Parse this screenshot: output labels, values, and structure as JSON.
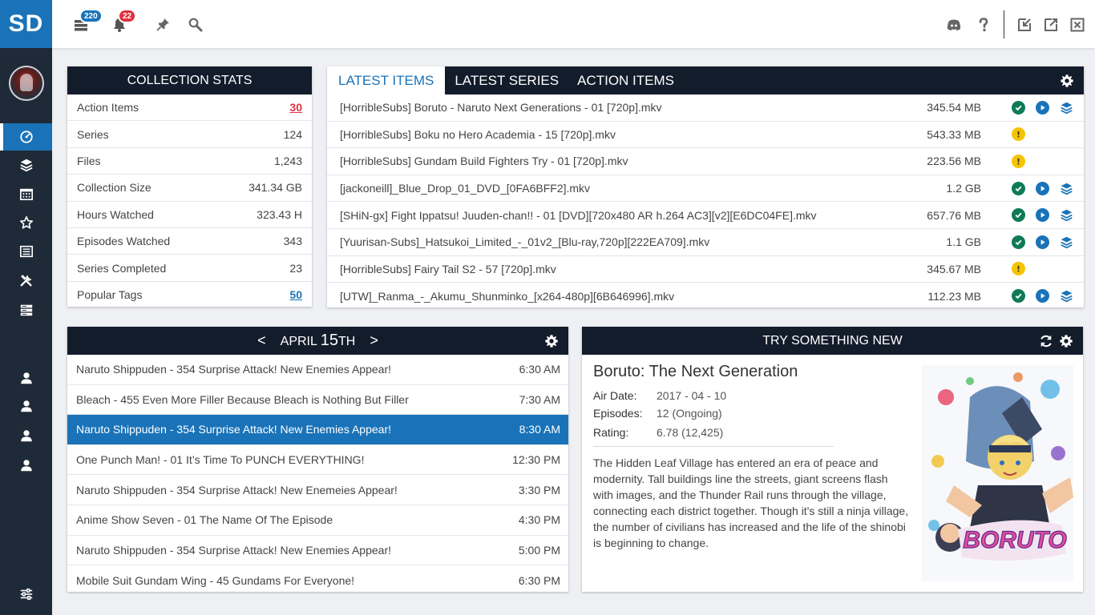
{
  "sidebar": {
    "logo": "SD",
    "items": [
      "dashboard-icon",
      "layers-icon",
      "calendar-icon",
      "star-icon",
      "list-icon",
      "tools-icon",
      "server-icon",
      "user-icon",
      "user-icon",
      "user-icon",
      "user-icon",
      "sliders-icon"
    ]
  },
  "topbar": {
    "queue_count": "220",
    "notification_count": "22",
    "queue_badge_color": "#1a73b8",
    "notification_badge_color": "#e0303f"
  },
  "collection_stats": {
    "title": "COLLECTION STATS",
    "rows": [
      {
        "label": "Action Items",
        "value": "30"
      },
      {
        "label": "Series",
        "value": "124"
      },
      {
        "label": "Files",
        "value": "1,243"
      },
      {
        "label": "Collection Size",
        "value": "341.34 GB"
      },
      {
        "label": "Hours Watched",
        "value": "323.43 H"
      },
      {
        "label": "Episodes Watched",
        "value": "343"
      },
      {
        "label": "Series Completed",
        "value": "23"
      },
      {
        "label": "Popular Tags",
        "value": "50"
      }
    ]
  },
  "latest": {
    "tabs": [
      "LATEST ITEMS",
      "LATEST SERIES",
      "ACTION ITEMS"
    ],
    "files": [
      {
        "name": "[HorribleSubs] Boruto - Naruto Next Generations - 01 [720p].mkv",
        "size": "345.54 MB",
        "status": "ok"
      },
      {
        "name": "[HorribleSubs] Boku no Hero Academia - 15 [720p].mkv",
        "size": "543.33 MB",
        "status": "warn"
      },
      {
        "name": "[HorribleSubs] Gundam Build Fighters Try - 01 [720p].mkv",
        "size": "223.56 MB",
        "status": "warn"
      },
      {
        "name": "[jackoneill]_Blue_Drop_01_DVD_[0FA6BFF2].mkv",
        "size": "1.2 GB",
        "status": "ok"
      },
      {
        "name": "[SHiN-gx] Fight Ippatsu! Juuden-chan!! - 01 [DVD][720x480 AR h.264 AC3][v2][E6DC04FE].mkv",
        "size": "657.76 MB",
        "status": "ok"
      },
      {
        "name": "[Yuurisan-Subs]_Hatsukoi_Limited_-_01v2_[Blu-ray,720p][222EA709].mkv",
        "size": "1.1 GB",
        "status": "ok"
      },
      {
        "name": "[HorribleSubs] Fairy Tail S2 - 57 [720p].mkv",
        "size": "345.67 MB",
        "status": "warn"
      },
      {
        "name": "[UTW]_Ranma_-_Akumu_Shunminko_[x264-480p][6B646996].mkv",
        "size": "112.23 MB",
        "status": "ok"
      }
    ]
  },
  "calendar": {
    "prev": "<",
    "next": ">",
    "month": "APRIL",
    "day": "15",
    "suffix": "TH",
    "rows": [
      {
        "title": "Naruto Shippuden - 354 Surprise Attack! New Enemies Appear!",
        "time": "6:30 AM"
      },
      {
        "title": "Bleach - 455 Even More Filler Because Bleach is Nothing But Filler",
        "time": "7:30 AM"
      },
      {
        "title": "Naruto Shippuden - 354 Surprise Attack! New Enemies Appear!",
        "time": "8:30 AM"
      },
      {
        "title": "One Punch Man! - 01 It’s Time To PUNCH EVERYTHING!",
        "time": "12:30 PM"
      },
      {
        "title": "Naruto Shippuden - 354 Surprise Attack! New Enemeies Appear!",
        "time": "3:30 PM"
      },
      {
        "title": "Anime Show Seven - 01 The Name Of The Episode",
        "time": "4:30 PM"
      },
      {
        "title": "Naruto Shippuden - 354 Surprise Attack! New Enemies Appear!",
        "time": "5:00 PM"
      },
      {
        "title": "Mobile Suit Gundam Wing - 45 Gundams For Everyone!",
        "time": "6:30 PM"
      }
    ]
  },
  "try_new": {
    "header": "TRY SOMETHING NEW",
    "title": "Boruto: The Next Generation",
    "air_date_label": "Air Date:",
    "air_date": "2017 - 04 - 10",
    "episodes_label": "Episodes:",
    "episodes": "12 (Ongoing)",
    "rating_label": "Rating:",
    "rating": "6.78 (12,425)",
    "description": "The Hidden Leaf Village has entered an era of peace and modernity. Tall buildings line the streets, giant screens flash with images, and the Thunder Rail runs through the village, connecting each district together. Though it's still a ninja village, the number of civilians has increased and the life of the shinobi is beginning to change.",
    "poster_logo": "BORUTO"
  },
  "colors": {
    "accent": "#1a73b8",
    "ok": "#0f7a55",
    "warn": "#f5c400",
    "play": "#1a73b8",
    "dark": "#131c2b",
    "red": "#e0303f"
  }
}
